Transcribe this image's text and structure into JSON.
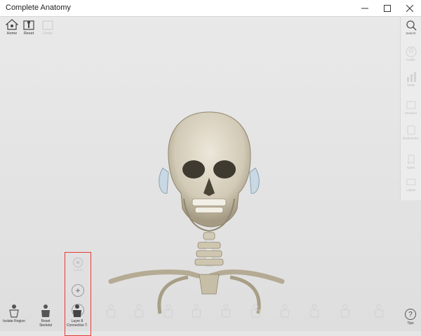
{
  "window": {
    "title": "Complete Anatomy",
    "controls": [
      "minimize",
      "maximize",
      "close"
    ]
  },
  "toolbar": {
    "home_label": "Home",
    "reset_label": "Reset",
    "third_label": "Undo"
  },
  "right_panel": {
    "search_label": "Search",
    "items": [
      "Profile",
      "Tasks",
      "Sections",
      "Bookmarks",
      "Notes",
      "Labels"
    ]
  },
  "zoom_controls": {
    "rotate_label": "Rotate",
    "zoom_in_symbol": "+",
    "zoom_out_symbol": "–"
  },
  "bottom_bar": {
    "isolate_label": "Isolate Region",
    "reset_label": "Reset",
    "skeletal_label": "Skeletal",
    "layer_label": "Layer 8",
    "layer_sub_label": "Connective T.",
    "tips_label": "Tips",
    "tips_symbol": "?"
  },
  "colors": {
    "highlight": "#e53935",
    "bone": "#d8d1bf",
    "background": "#e6e6e6"
  }
}
